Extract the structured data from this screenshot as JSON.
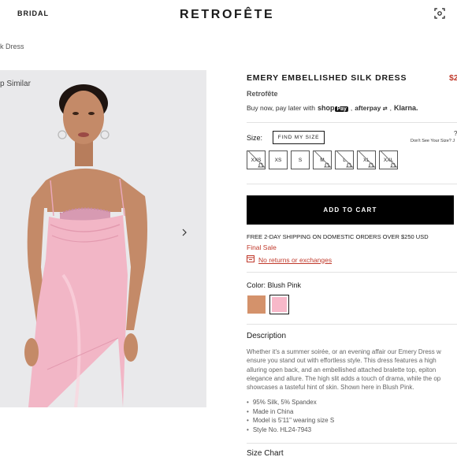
{
  "header": {
    "nav_left": "BRIDAL",
    "logo": "RETROFÊTE",
    "scan_icon": "scan-icon"
  },
  "breadcrumb": "k Dress",
  "gallery": {
    "shop_similar": "p Similar",
    "next_icon": "chevron-right-icon"
  },
  "product": {
    "title": "EMERY EMBELLISHED SILK DRESS",
    "price": "$2",
    "brand": "Retrofête",
    "pay_later_text": "Buy now, pay later with",
    "pay_providers": {
      "shop": "shop",
      "pay": "Pay",
      "afterpay": "afterpay",
      "klarna": "Klarna."
    },
    "size": {
      "label": "Size:",
      "find_my_size": "FIND MY SIZE",
      "help_text": "Don't See Your Size? J",
      "help_mark": "?",
      "options": [
        {
          "label": "XXS",
          "available": false
        },
        {
          "label": "XS",
          "available": true
        },
        {
          "label": "S",
          "available": true
        },
        {
          "label": "M",
          "available": false
        },
        {
          "label": "L",
          "available": false
        },
        {
          "label": "XL",
          "available": false
        },
        {
          "label": "XXL",
          "available": false
        }
      ]
    },
    "add_to_cart": "ADD TO CART",
    "shipping_note": "FREE 2-DAY SHIPPING ON DOMESTIC ORDERS OVER $250 USD",
    "final_sale": "Final Sale",
    "returns": "No returns or exchanges",
    "color": {
      "label": "Color: Blush Pink",
      "swatches": [
        {
          "name": "tan",
          "hex": "#d4926b",
          "selected": false
        },
        {
          "name": "blush-pink",
          "hex": "#f7b8c9",
          "selected": true
        }
      ]
    },
    "description_heading": "Description",
    "description_lines": [
      "Whether it's a summer soirée, or an evening affair our Emery Dress w",
      "ensure you stand out with effortless style. This dress features a high",
      "alluring open back, and an embellished attached bralette top, epiton",
      "elegance and allure. The high slit adds a touch of drama, while the op",
      "showcases a tasteful hint of skin. Shown here in Blush Pink."
    ],
    "details": [
      "95% Silk, 5% Spandex",
      "Made in China",
      "Model is 5'11\" wearing size S",
      "Style No. HL24-7943"
    ],
    "size_chart": "Size Chart"
  },
  "colors": {
    "accent_red": "#c0392b",
    "dress_pink": "#f2b6c6",
    "background_gray": "#e9e9eb"
  }
}
